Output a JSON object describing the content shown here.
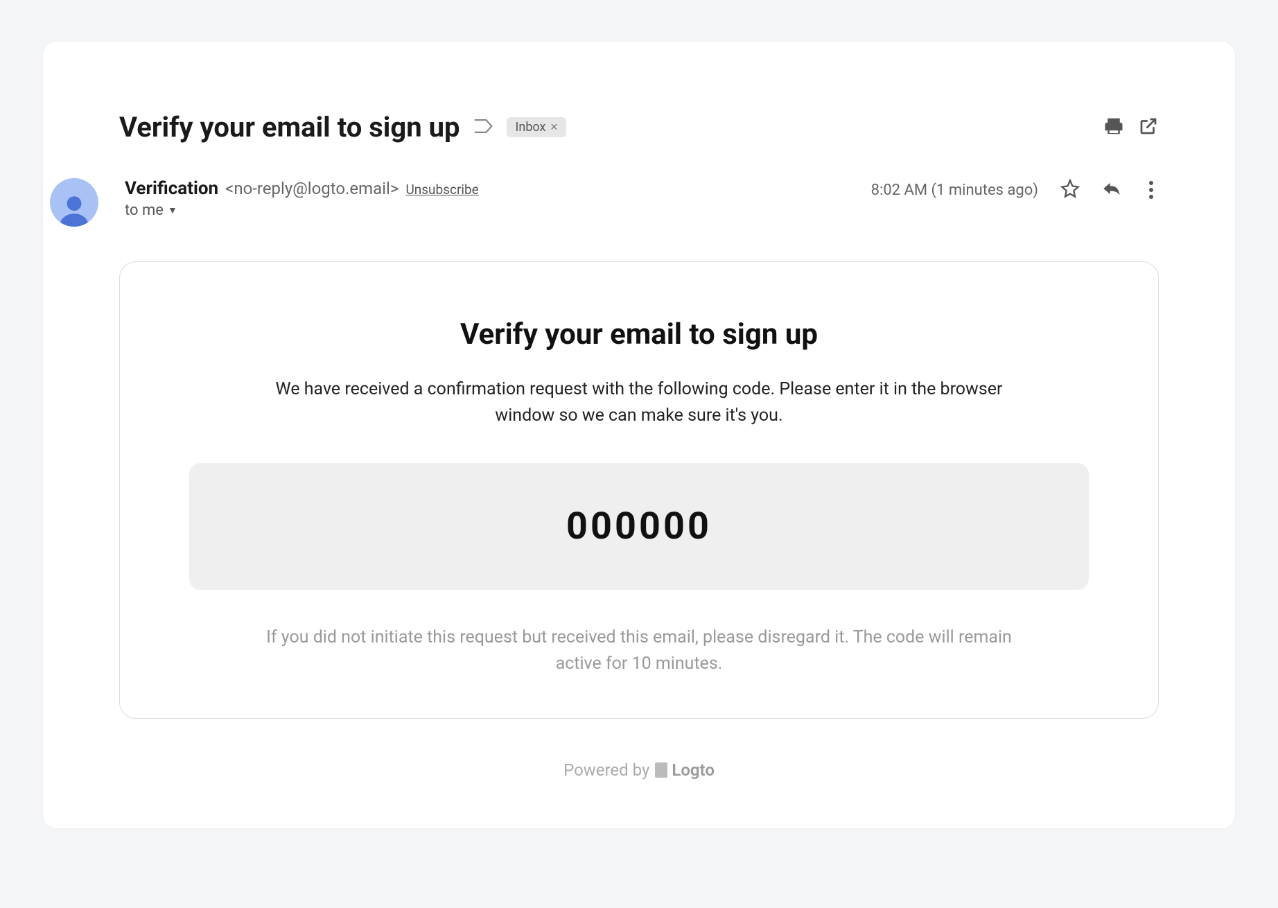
{
  "header": {
    "subject": "Verify your email to sign up",
    "inbox_label": "Inbox"
  },
  "sender": {
    "name": "Verification",
    "email": "<no-reply@logto.email>",
    "unsubscribe": "Unsubscribe",
    "recipient": "to me"
  },
  "meta": {
    "timestamp": "8:02 AM (1 minutes ago)"
  },
  "body": {
    "title": "Verify your email to sign up",
    "description": "We have received a confirmation request with the following code. Please enter it in the browser window so we can make sure it's you.",
    "code": "000000",
    "note": "If you did not initiate this request but received this email, please disregard it. The code will remain active for 10 minutes."
  },
  "footer": {
    "powered_by": "Powered by",
    "brand": "Logto"
  }
}
